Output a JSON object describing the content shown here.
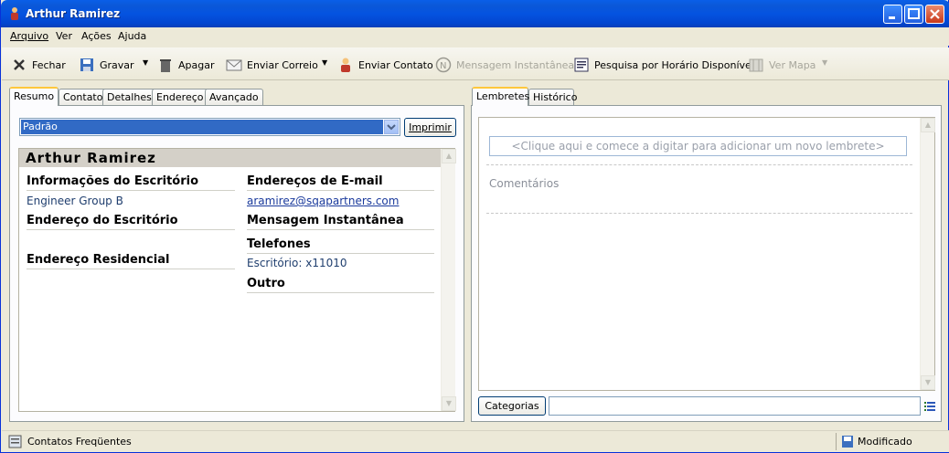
{
  "window": {
    "title": "Arthur Ramirez"
  },
  "menu": [
    "Arquivo",
    "Ver",
    "Ações",
    "Ajuda"
  ],
  "toolbar": {
    "fechar": "Fechar",
    "gravar": "Gravar",
    "apagar": "Apagar",
    "enviar_correio": "Enviar Correio",
    "enviar_contato": "Enviar Contato",
    "mensagem": "Mensagem Instantânea",
    "pesquisa": "Pesquisa por Horário Disponível",
    "ver_mapa": "Ver Mapa"
  },
  "left_tabs": [
    "Resumo",
    "Contato",
    "Detalhes",
    "Endereço",
    "Avançado"
  ],
  "format_select": "Padrão",
  "print_button": "Imprimir",
  "card": {
    "name": "Arthur Ramirez",
    "office_info": "Informações do Escritório",
    "company": "Engineer Group B",
    "office_address": "Endereço do Escritório",
    "home_address": "Endereço Residencial",
    "emails": "Endereços de E-mail",
    "email": "aramirez@sqapartners.com",
    "im": "Mensagem Instantânea",
    "phones": "Telefones",
    "phone": "Escritório: x11010",
    "other": "Outro"
  },
  "right_tabs": [
    "Lembretes",
    "Histórico"
  ],
  "reminder_placeholder": "<Clique aqui e comece a digitar para adicionar um novo lembrete>",
  "comments_label": "Comentários",
  "categories_button": "Categorias",
  "status": {
    "left": "Contatos Freqüentes",
    "right": "Modificado"
  }
}
